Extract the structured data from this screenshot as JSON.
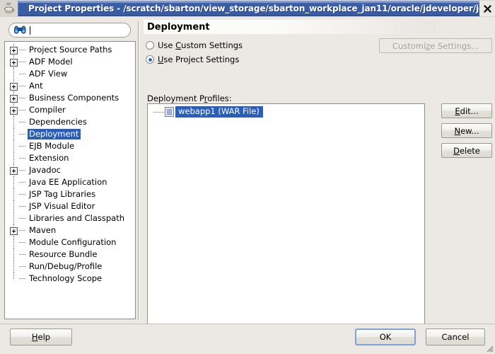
{
  "window": {
    "title": "Project Properties - /scratch/sbarton/view_storage/sbarton_workplace_jan11/oracle/jdeveloper/jdev/my",
    "app_icon": "java-coffee-cup-icon",
    "close_label": "✕"
  },
  "sidebar": {
    "search": {
      "value": "",
      "placeholder": "",
      "icon": "binoculars-icon"
    },
    "items": [
      {
        "label": "Project Source Paths",
        "expandable": true,
        "selected": false
      },
      {
        "label": "ADF Model",
        "expandable": true,
        "selected": false
      },
      {
        "label": "ADF View",
        "expandable": false,
        "selected": false
      },
      {
        "label": "Ant",
        "expandable": true,
        "selected": false
      },
      {
        "label": "Business Components",
        "expandable": true,
        "selected": false
      },
      {
        "label": "Compiler",
        "expandable": true,
        "selected": false
      },
      {
        "label": "Dependencies",
        "expandable": false,
        "selected": false
      },
      {
        "label": "Deployment",
        "expandable": false,
        "selected": true
      },
      {
        "label": "EJB Module",
        "expandable": false,
        "selected": false
      },
      {
        "label": "Extension",
        "expandable": false,
        "selected": false
      },
      {
        "label": "Javadoc",
        "expandable": true,
        "selected": false
      },
      {
        "label": "Java EE Application",
        "expandable": false,
        "selected": false
      },
      {
        "label": "JSP Tag Libraries",
        "expandable": false,
        "selected": false
      },
      {
        "label": "JSP Visual Editor",
        "expandable": false,
        "selected": false
      },
      {
        "label": "Libraries and Classpath",
        "expandable": false,
        "selected": false
      },
      {
        "label": "Maven",
        "expandable": true,
        "selected": false
      },
      {
        "label": "Module Configuration",
        "expandable": false,
        "selected": false
      },
      {
        "label": "Resource Bundle",
        "expandable": false,
        "selected": false
      },
      {
        "label": "Run/Debug/Profile",
        "expandable": false,
        "selected": false
      },
      {
        "label": "Technology Scope",
        "expandable": false,
        "selected": false
      }
    ]
  },
  "page": {
    "title": "Deployment",
    "settings_mode": {
      "custom": {
        "label_before": "Use ",
        "label_mnemonic": "C",
        "label_after": "ustom Settings",
        "selected": false
      },
      "project": {
        "label_before": "",
        "label_mnemonic": "U",
        "label_after": "se Project Settings",
        "selected": true
      }
    },
    "customize_button": {
      "before": "Customi",
      "mnemonic": "z",
      "after": "e Settings...",
      "enabled": false
    },
    "profiles": {
      "label_before": "Deployment P",
      "label_mnemonic": "r",
      "label_after": "ofiles:",
      "items": [
        {
          "label": "webapp1 (WAR File)",
          "icon": "war-file-icon",
          "selected": true
        }
      ]
    },
    "side_buttons": [
      {
        "before": "",
        "mnemonic": "E",
        "after": "dit...",
        "name": "edit"
      },
      {
        "before": "",
        "mnemonic": "N",
        "after": "ew...",
        "name": "new"
      },
      {
        "before": "",
        "mnemonic": "D",
        "after": "elete",
        "name": "delete"
      }
    ]
  },
  "footer": {
    "help": {
      "before": "",
      "mnemonic": "H",
      "after": "elp"
    },
    "ok": "OK",
    "cancel": "Cancel"
  },
  "colors": {
    "title_bar": "#3a5da8",
    "selection": "#2b5ebb",
    "dialog_bg": "#ece9e4",
    "focus_ring": "#7ea3d8",
    "radio_dot": "#2b6ed4"
  }
}
